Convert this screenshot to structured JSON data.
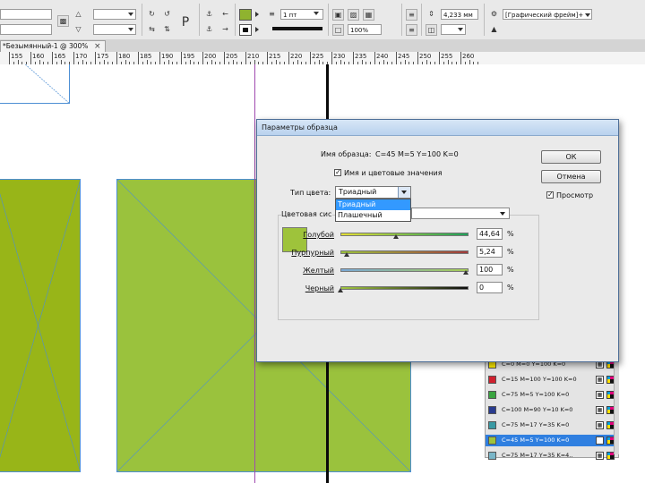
{
  "control_bar": {
    "stroke_weight": "1 пт",
    "zoom_field": "100%",
    "offset_field": "4,233 мм",
    "style_field": "[Графический фрейм]+",
    "fill_color": "#8fb32f"
  },
  "tab": {
    "title": "*Безымянный-1 @ 300%",
    "close": "×"
  },
  "ruler": {
    "labels": [
      "155",
      "160",
      "165",
      "170",
      "175",
      "180",
      "185",
      "190",
      "195",
      "200",
      "205",
      "210",
      "215",
      "220",
      "225",
      "230",
      "235",
      "240",
      "245",
      "250",
      "255",
      "260"
    ]
  },
  "swatches": [
    {
      "name": "C=0 M=0 Y=100 K=0",
      "color": "#ffed00",
      "selected": false
    },
    {
      "name": "C=15 M=100 Y=100 K=0",
      "color": "#d0202e",
      "selected": false
    },
    {
      "name": "C=75 M=5 Y=100 K=0",
      "color": "#3aa540",
      "selected": false
    },
    {
      "name": "C=100 M=90 Y=10 K=0",
      "color": "#293b8e",
      "selected": false
    },
    {
      "name": "C=75 M=17 Y=35 K=0",
      "color": "#3a9aa4",
      "selected": false
    },
    {
      "name": "C=45 M=5 Y=100 K=0",
      "color": "#9ec33b",
      "selected": true
    },
    {
      "name": "C=75 M=17 Y=35 K=4..",
      "color": "#7ab6c8",
      "selected": false
    }
  ],
  "dialog": {
    "title": "Параметры образца",
    "swatch_name_label": "Имя образца:",
    "swatch_name_value": "C=45 M=5 Y=100 K=0",
    "name_with_value_label": "Имя и цветовые значения",
    "color_type_label": "Тип цвета:",
    "color_type_value": "Триадный",
    "color_type_options": [
      "Триадный",
      "Плашечный"
    ],
    "color_mode_label": "Цветовая сис",
    "preview_color": "#9ec33b",
    "ok_label": "ОК",
    "cancel_label": "Отмена",
    "preview_label": "Просмотр",
    "channels": [
      {
        "label": "Голубой",
        "value": "44,64",
        "fraction": 0.4464,
        "gradient": "linear-gradient(90deg,#e3df35,#1fa05a)"
      },
      {
        "label": "Пурпурный",
        "value": "5,24",
        "fraction": 0.0524,
        "gradient": "linear-gradient(90deg,#9bc23b,#a23b3b)"
      },
      {
        "label": "Желтый",
        "value": "100",
        "fraction": 1.0,
        "gradient": "linear-gradient(90deg,#7aa8d6,#a6cd55)"
      },
      {
        "label": "Черный",
        "value": "0",
        "fraction": 0.0,
        "gradient": "linear-gradient(90deg,#a0c540,#0d0d0d)"
      }
    ],
    "percent_sign": "%"
  },
  "canvas": {
    "frame_fill_left": "#98b518",
    "frame_fill_right": "#9ac23d",
    "frame_border": "#4d8fd4"
  }
}
